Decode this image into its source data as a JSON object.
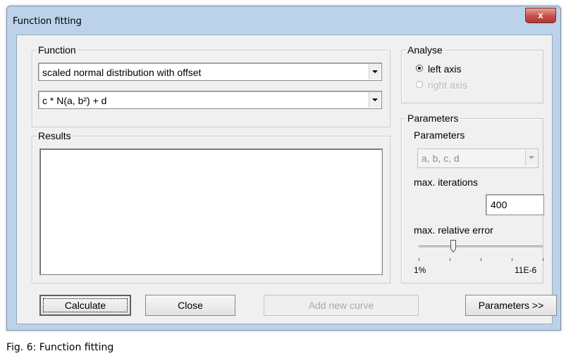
{
  "window": {
    "title": "Function fitting",
    "close_glyph": "x"
  },
  "function_group": {
    "legend": "Function",
    "distribution": "scaled normal distribution with offset",
    "formula": "c * N(a, b²) + d"
  },
  "results_group": {
    "legend": "Results",
    "text": ""
  },
  "analyse_group": {
    "legend": "Analyse",
    "left_axis": "left axis",
    "right_axis": "right axis",
    "selected": "left axis"
  },
  "parameters_group": {
    "legend": "Parameters",
    "parameters_label": "Parameters",
    "parameters_value": "a, b, c, d",
    "max_iterations_label": "max. iterations",
    "max_iterations_value": "400",
    "max_error_label": "max. relative error",
    "slider_min_label": "1%",
    "slider_max_label": "11E-6",
    "slider_level": 0.28
  },
  "buttons": {
    "calculate": "Calculate",
    "close": "Close",
    "add_new_curve": "Add new curve",
    "parameters": "Parameters >>"
  },
  "caption": "Fig. 6: Function fitting"
}
